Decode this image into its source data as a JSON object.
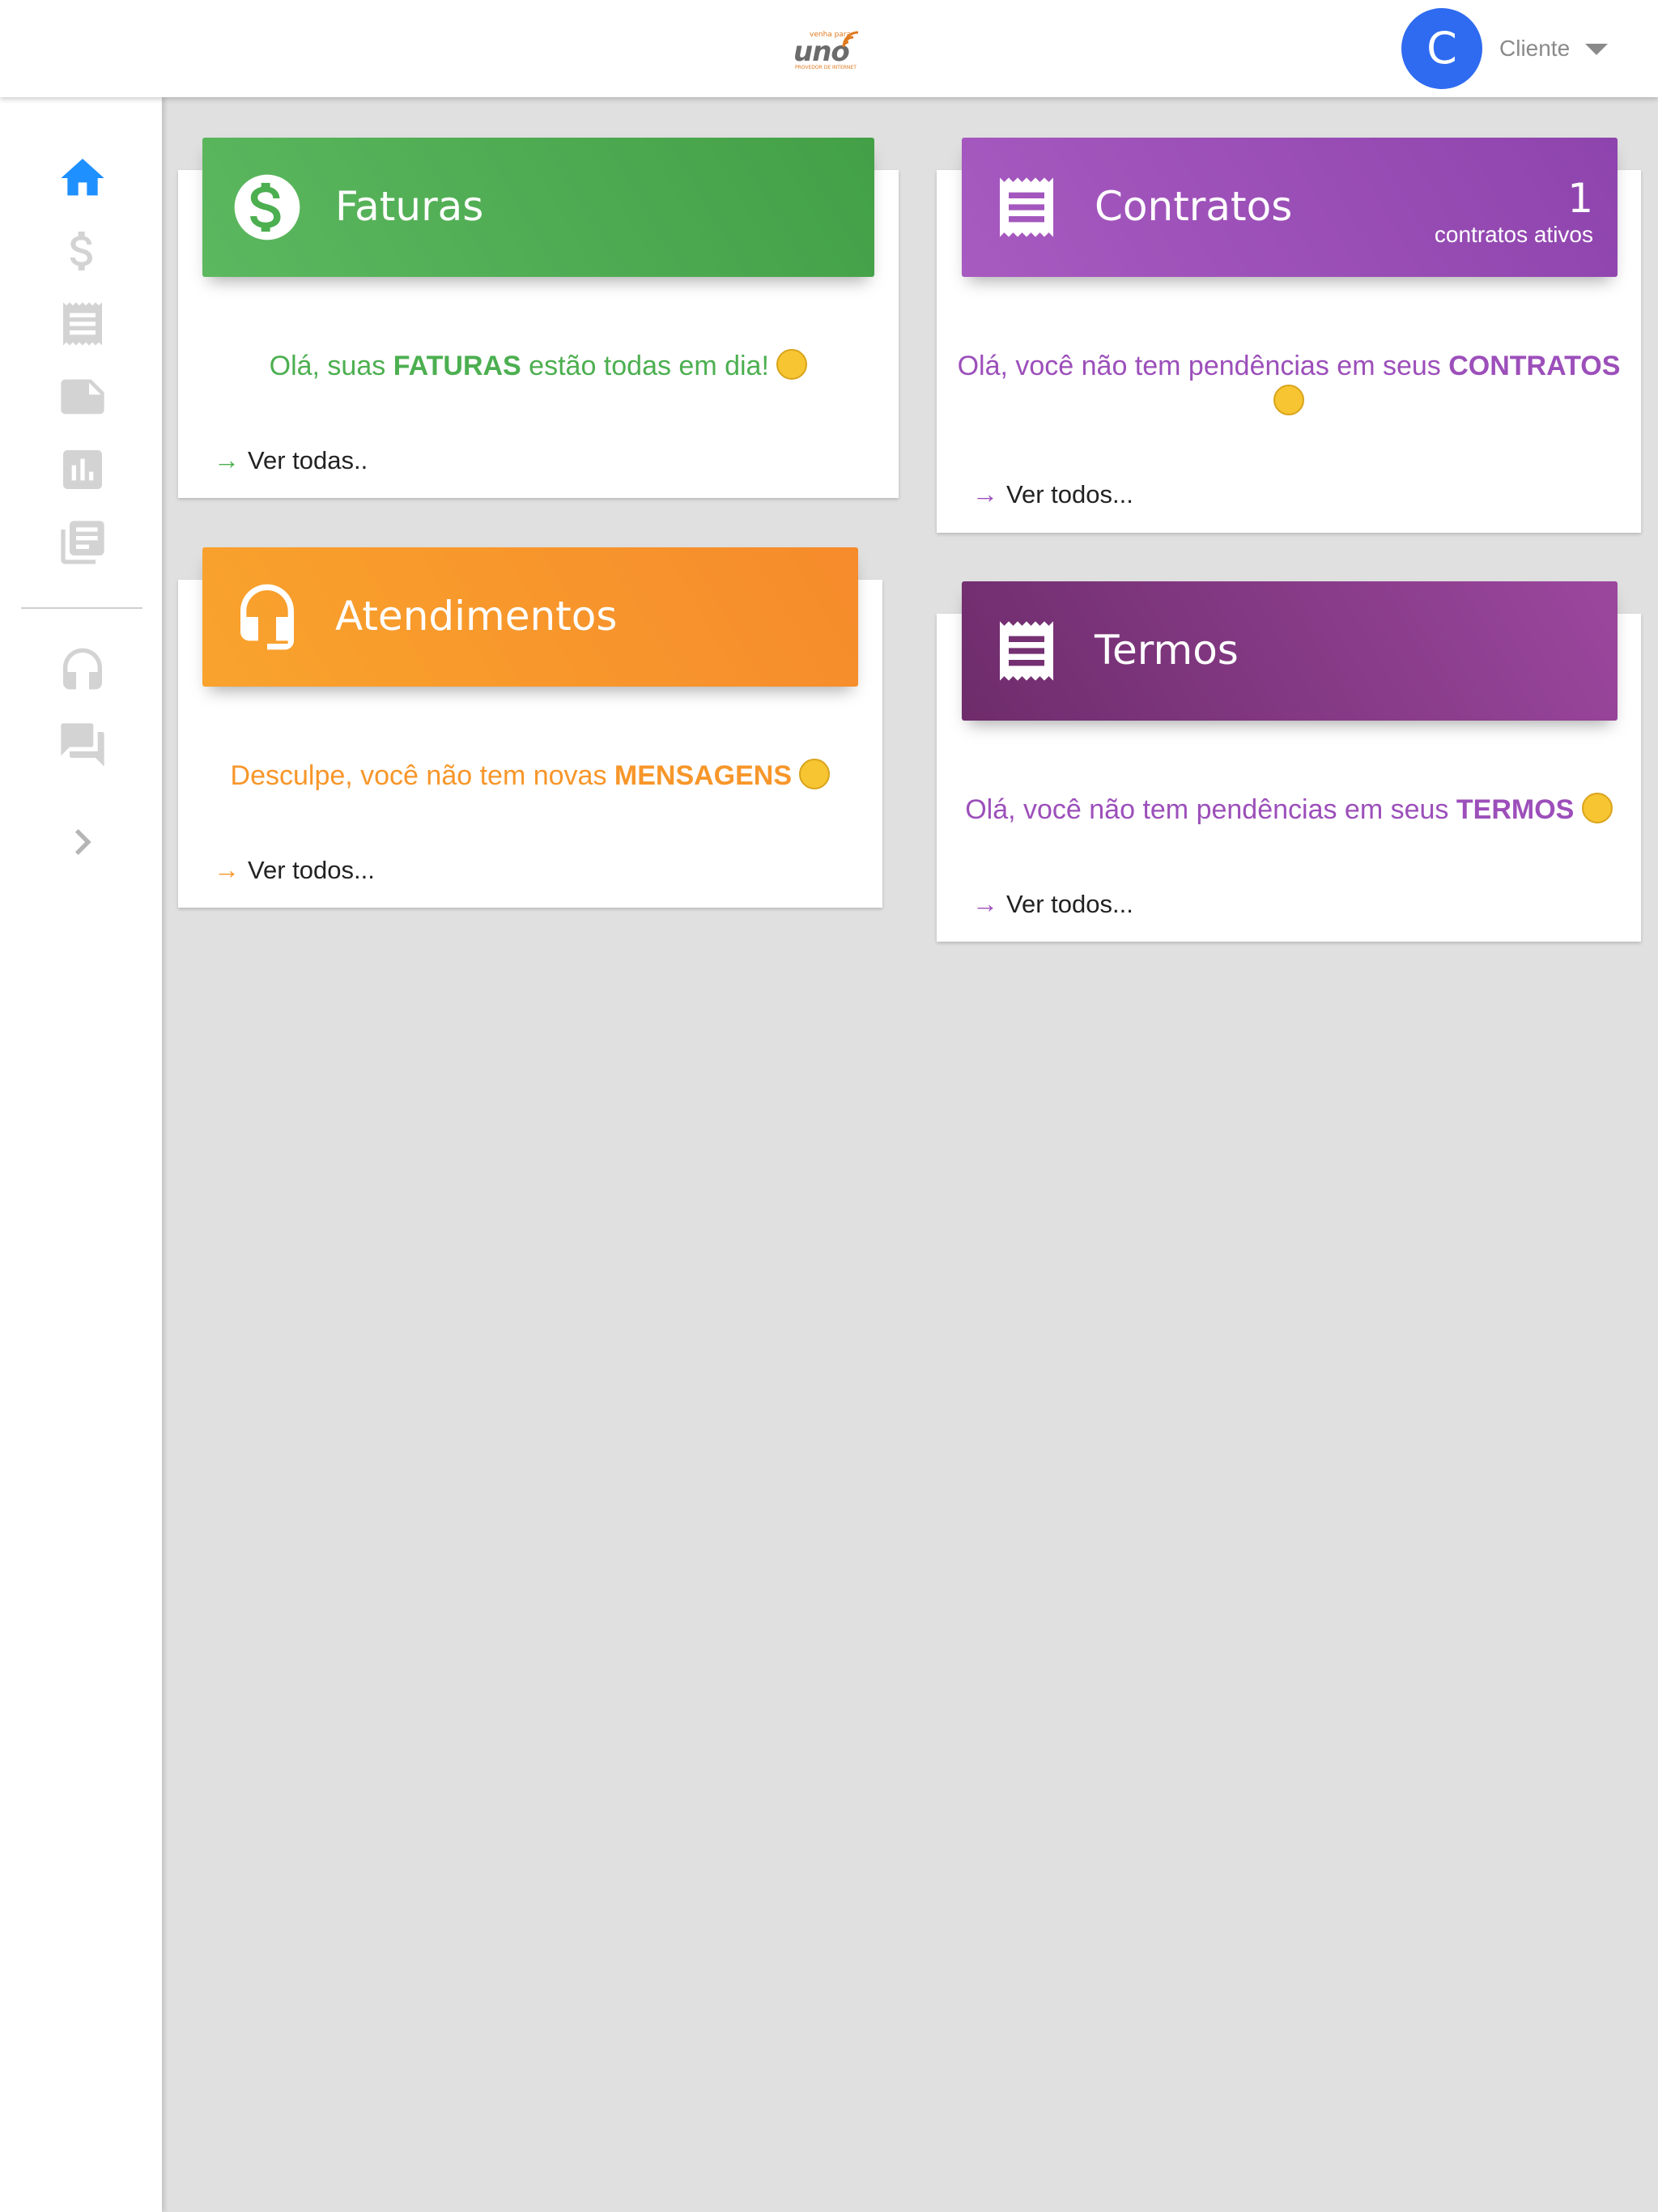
{
  "header": {
    "logo": {
      "brand": "uno",
      "top_text": "venha para",
      "tagline": "PROVEDOR DE INTERNET"
    },
    "avatar_initial": "C",
    "user_label": "Cliente",
    "avatar_color": "#2f6bf0"
  },
  "sidebar": {
    "items": [
      {
        "icon": "home-icon",
        "active": true
      },
      {
        "icon": "dollar-icon"
      },
      {
        "icon": "receipt-icon"
      },
      {
        "icon": "note-icon"
      },
      {
        "icon": "bar-chart-icon"
      },
      {
        "icon": "library-books-icon"
      },
      {
        "icon": "headset-icon"
      },
      {
        "icon": "forum-icon"
      },
      {
        "icon": "chevron-right-icon"
      }
    ],
    "active_color": "#1e90ff",
    "icon_color": "#d3d3d3"
  },
  "cards": {
    "faturas": {
      "title": "Faturas",
      "msg_pre": "Olá, suas ",
      "msg_bold": "FATURAS",
      "msg_post": " estão todas em dia! ",
      "link": "Ver todas..",
      "color": "#4caf50",
      "icon": "dollar-circle-icon"
    },
    "contratos": {
      "title": "Contratos",
      "count": "1",
      "count_label": "contratos ativos",
      "msg_pre": "Olá, você não tem pendências em seus ",
      "msg_bold": "CONTRATOS",
      "link": "Ver todos...",
      "color": "#9c4fba",
      "icon": "receipt-icon"
    },
    "atendimentos": {
      "title": "Atendimentos",
      "msg_pre": "Desculpe, você não tem novas ",
      "msg_bold": "MENSAGENS",
      "link": "Ver todos...",
      "color": "#f7962a",
      "icon": "headset-icon"
    },
    "termos": {
      "title": "Termos",
      "msg_pre": "Olá, você não tem pendências em seus ",
      "msg_bold": "TERMOS",
      "link": "Ver todos...",
      "color": "#8a3f8d",
      "icon": "receipt-icon"
    }
  }
}
